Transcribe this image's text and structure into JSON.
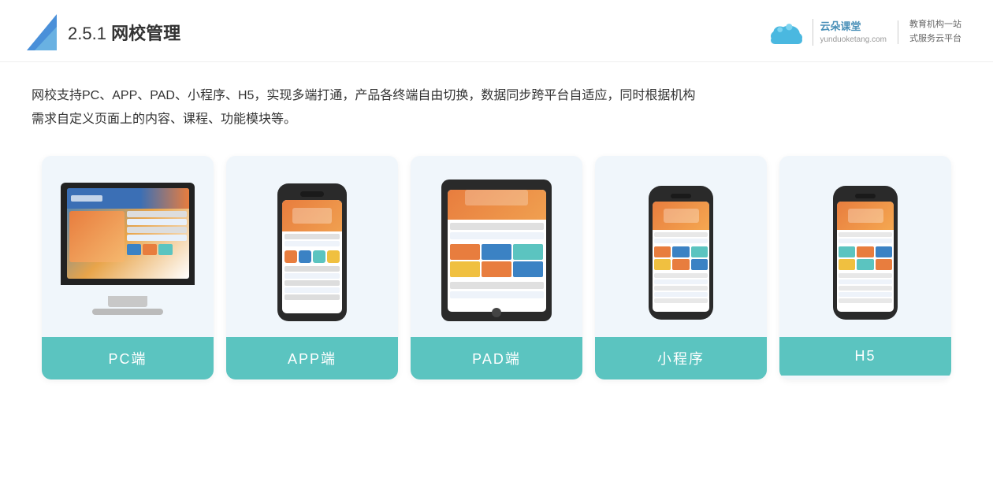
{
  "header": {
    "section_number": "2.5.1",
    "title_plain": "",
    "title_bold": "网校管理",
    "brand": {
      "name": "云朵课堂",
      "site": "yunduoketang.com",
      "tagline1": "教育机构一站",
      "tagline2": "式服务云平台"
    }
  },
  "description": {
    "line1": "网校支持PC、APP、PAD、小程序、H5，实现多端打通，产品各终端自由切换，数据同步跨平台自适应，同时根据机构",
    "line2": "需求自定义页面上的内容、课程、功能模块等。"
  },
  "cards": [
    {
      "id": "pc",
      "label": "PC端"
    },
    {
      "id": "app",
      "label": "APP端"
    },
    {
      "id": "pad",
      "label": "PAD端"
    },
    {
      "id": "mini",
      "label": "小程序"
    },
    {
      "id": "h5",
      "label": "H5"
    }
  ],
  "colors": {
    "card_bg": "#eef5fb",
    "card_label_bg": "#5bc4c0",
    "card_label_text": "#ffffff",
    "accent_orange": "#e87d3e",
    "accent_blue": "#3b6fb5",
    "screen_bg": "#ffffff"
  }
}
